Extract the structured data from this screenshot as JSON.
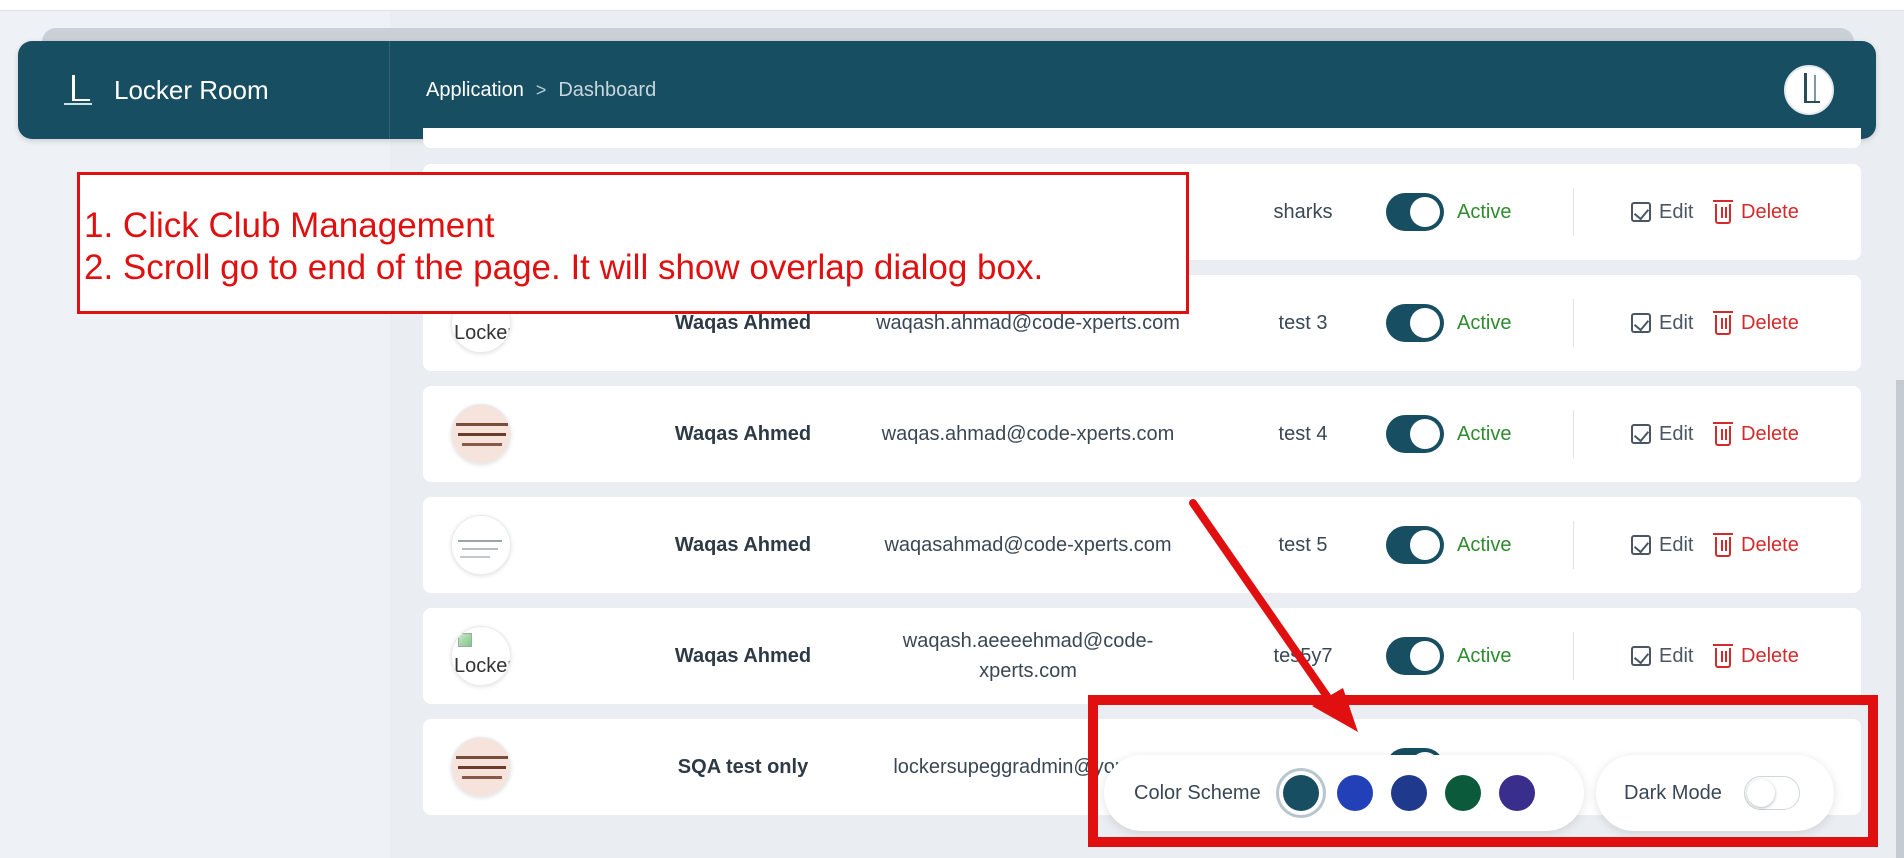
{
  "header": {
    "brand_title": "Locker Room",
    "breadcrumb_root": "Application",
    "breadcrumb_separator": ">",
    "breadcrumb_current": "Dashboard"
  },
  "rows": [
    {
      "name": "",
      "email": "",
      "club": "sharks",
      "status": "Active",
      "avatar_alt": ""
    },
    {
      "name": "Waqas Ahmed",
      "email": "waqash.ahmad@code-xperts.com",
      "club": "test 3",
      "status": "Active",
      "avatar_alt": "Locker"
    },
    {
      "name": "Waqas Ahmed",
      "email": "waqas.ahmad@code-xperts.com",
      "club": "test 4",
      "status": "Active",
      "avatar_alt": ""
    },
    {
      "name": "Waqas Ahmed",
      "email": "waqasahmad@code-xperts.com",
      "club": "test 5",
      "status": "Active",
      "avatar_alt": ""
    },
    {
      "name": "Waqas Ahmed",
      "email": "waqash.aeeeehmad@code-xperts.com",
      "club": "tes5y7",
      "status": "Active",
      "avatar_alt": "Locker"
    },
    {
      "name": "SQA test only",
      "email": "lockersupeggradmin@yopmail",
      "club": "",
      "status": "",
      "avatar_alt": ""
    }
  ],
  "actions": {
    "edit_label": "Edit",
    "delete_label": "Delete"
  },
  "annotation": {
    "line1": "1. Click Club Management",
    "line2": "2. Scroll go to end of the page. It will show overlap dialog box."
  },
  "settings": {
    "color_scheme_label": "Color Scheme",
    "dark_mode_label": "Dark Mode",
    "dark_mode_on": false,
    "swatches": [
      "#184e61",
      "#2241b8",
      "#1f3a8c",
      "#0c5a3c",
      "#3a2e8c"
    ],
    "selected_swatch": 0
  },
  "colors": {
    "header_bg": "#184e61",
    "status_active": "#2e8b2e",
    "delete": "#d12b2b",
    "annotation": "#e01010"
  }
}
